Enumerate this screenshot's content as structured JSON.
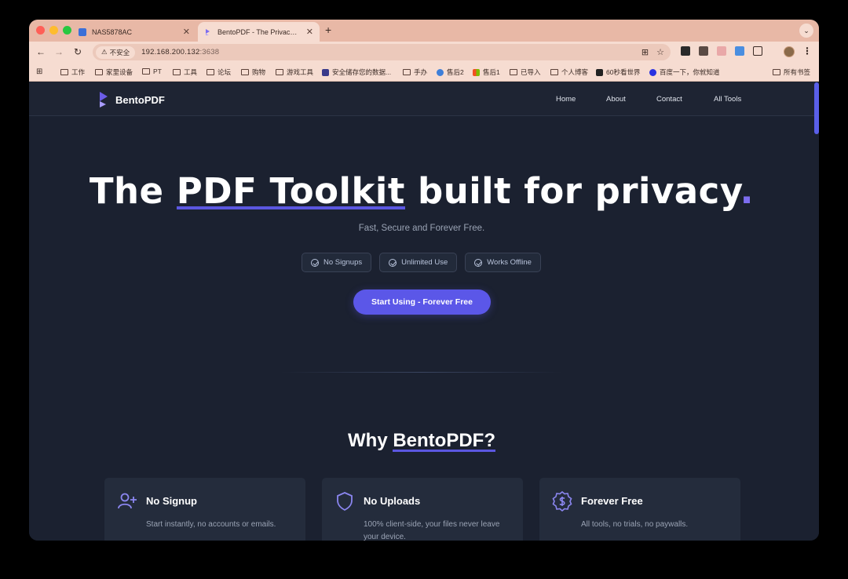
{
  "browser": {
    "tabs": [
      {
        "title": "NAS5878AC",
        "active": false
      },
      {
        "title": "BentoPDF - The Privacy First",
        "active": true
      }
    ],
    "address": {
      "security_label": "不安全",
      "host": "192.168.200.132",
      "port": ":3638"
    },
    "bookmarks": [
      "工作",
      "家里设备",
      "PT",
      "工具",
      "论坛",
      "购物",
      "游戏工具",
      "安全储存您的数据...",
      "手办",
      "售后2",
      "售后1",
      "已导入",
      "个人博客",
      "60秒看世界",
      "百度一下，你就知道",
      "所有书签"
    ]
  },
  "site": {
    "brand": "BentoPDF",
    "nav": [
      "Home",
      "About",
      "Contact",
      "All Tools"
    ]
  },
  "hero": {
    "title_pre": "The ",
    "title_highlight": "PDF Toolkit",
    "title_post": " built for privacy",
    "title_dot": ".",
    "subtitle": "Fast, Secure and Forever Free.",
    "badges": [
      "No Signups",
      "Unlimited Use",
      "Works Offline"
    ],
    "cta": "Start Using - Forever Free"
  },
  "why": {
    "heading_pre": "Why ",
    "heading_highlight": "BentoPDF?",
    "cards": [
      {
        "title": "No Signup",
        "desc": "Start instantly, no accounts or emails.",
        "icon": "user-plus-icon"
      },
      {
        "title": "No Uploads",
        "desc": "100% client-side, your files never leave your device.",
        "icon": "shield-icon"
      },
      {
        "title": "Forever Free",
        "desc": "All tools, no trials, no paywalls.",
        "icon": "dollar-badge-icon"
      }
    ]
  },
  "colors": {
    "accent": "#5b57e8",
    "page_bg": "#1b2130",
    "card_bg": "#242c3c",
    "browser_chrome": "#f6dcd1"
  }
}
